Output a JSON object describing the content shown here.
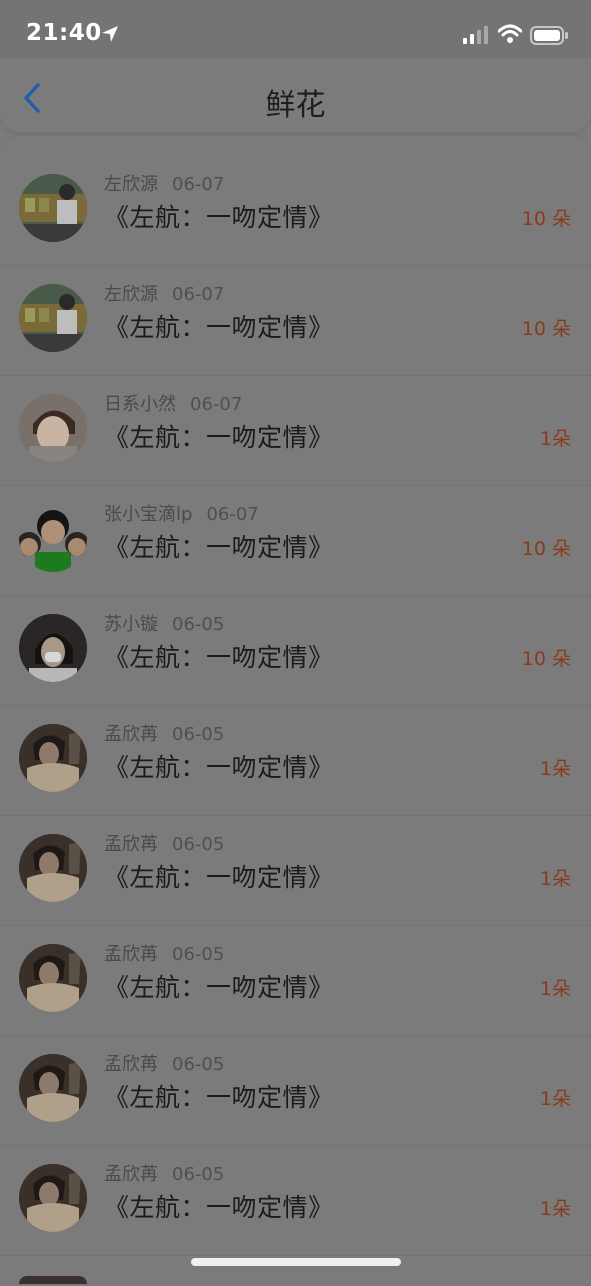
{
  "status_bar": {
    "time": "21:40"
  },
  "nav": {
    "title": "鲜花"
  },
  "items": [
    {
      "user": "左欣源",
      "date": "06-07",
      "title": "《左航：一吻定情》",
      "count": "10 朵",
      "avatar": "avatar-a"
    },
    {
      "user": "左欣源",
      "date": "06-07",
      "title": "《左航：一吻定情》",
      "count": "10 朵",
      "avatar": "avatar-a"
    },
    {
      "user": "日系小然",
      "date": "06-07",
      "title": "《左航：一吻定情》",
      "count": "1朵",
      "avatar": "avatar-b"
    },
    {
      "user": "张小宝滴lp",
      "date": "06-07",
      "title": "《左航：一吻定情》",
      "count": "10 朵",
      "avatar": "avatar-c"
    },
    {
      "user": "苏小镟",
      "date": "06-05",
      "title": "《左航：一吻定情》",
      "count": "10 朵",
      "avatar": "avatar-d"
    },
    {
      "user": "孟欣苒",
      "date": "06-05",
      "title": "《左航：一吻定情》",
      "count": "1朵",
      "avatar": "avatar-e"
    },
    {
      "user": "孟欣苒",
      "date": "06-05",
      "title": "《左航：一吻定情》",
      "count": "1朵",
      "avatar": "avatar-e"
    },
    {
      "user": "孟欣苒",
      "date": "06-05",
      "title": "《左航：一吻定情》",
      "count": "1朵",
      "avatar": "avatar-e"
    },
    {
      "user": "孟欣苒",
      "date": "06-05",
      "title": "《左航：一吻定情》",
      "count": "1朵",
      "avatar": "avatar-e"
    },
    {
      "user": "孟欣苒",
      "date": "06-05",
      "title": "《左航：一吻定情》",
      "count": "1朵",
      "avatar": "avatar-e"
    }
  ],
  "colors": {
    "accent": "#8a3a1a",
    "back_arrow": "#1f5fa6"
  }
}
